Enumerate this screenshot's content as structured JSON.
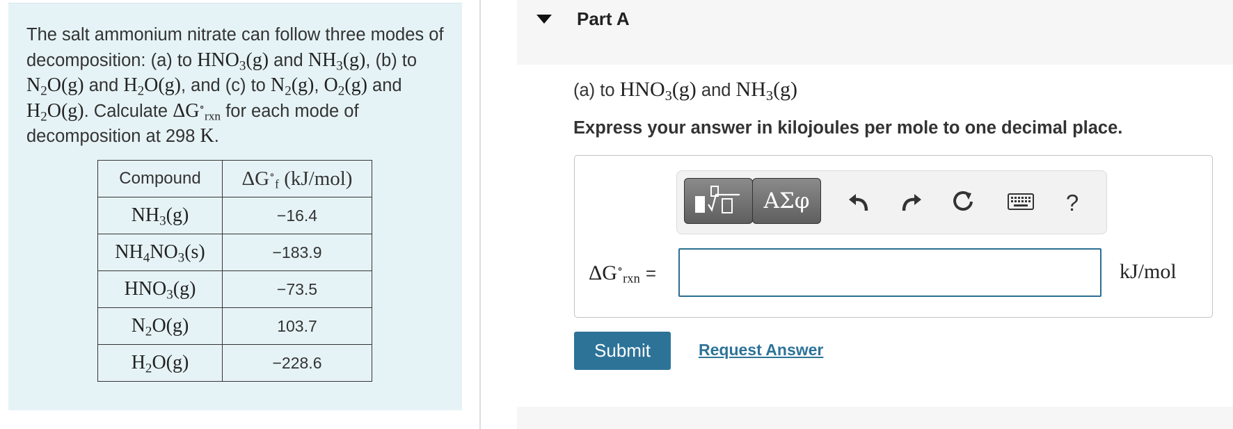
{
  "problem": {
    "t1": "The salt ammonium nitrate can follow three modes of decomposition: (a) to ",
    "t2": " and ",
    "t3": ", (b) to ",
    "t4": " and ",
    "t5": ", and (c) to ",
    "t6": ", ",
    "t7": " and ",
    "t8": ". Calculate ",
    "t9": " for each mode of decomposition at 298 ",
    "t10": ".",
    "hno3": "HNO",
    "hno3_sub": "3",
    "hno3_state": "(g)",
    "nh3": "NH",
    "nh3_sub": "3",
    "nh3_state": "(g)",
    "n2o_a": "N",
    "n2o_sub": "2",
    "n2o_b": "O(g)",
    "h2o_a": "H",
    "h2o_sub": "2",
    "h2o_b": "O(g)",
    "n2_a": "N",
    "n2_sub": "2",
    "n2_b": "(g)",
    "o2_a": "O",
    "o2_sub": "2",
    "o2_b": "(g)",
    "delta": "ΔG",
    "deg": "∘",
    "rxn": "rxn",
    "kelvin": "K"
  },
  "table": {
    "header_compound": "Compound",
    "header_delta": "ΔG",
    "header_deg": "∘",
    "header_f": "f",
    "header_unit": "(kJ/mol)",
    "rows": [
      {
        "a": "NH",
        "s1": "3",
        "b": "(g)",
        "s2": "",
        "c": "",
        "value": "−16.4"
      },
      {
        "a": "NH",
        "s1": "4",
        "b": "NO",
        "s2": "3",
        "c": "(s)",
        "value": "−183.9"
      },
      {
        "a": "HNO",
        "s1": "3",
        "b": "(g)",
        "s2": "",
        "c": "",
        "value": "−73.5"
      },
      {
        "a": "N",
        "s1": "2",
        "b": "O(g)",
        "s2": "",
        "c": "",
        "value": "103.7"
      },
      {
        "a": "H",
        "s1": "2",
        "b": "O(g)",
        "s2": "",
        "c": "",
        "value": "−228.6"
      }
    ]
  },
  "part": {
    "title": "Part A",
    "question_prefix": "(a) to ",
    "question_mid": " and ",
    "q_hno3": "HNO",
    "q_hno3_sub": "3",
    "q_hno3_state": "(g)",
    "q_nh3": "NH",
    "q_nh3_sub": "3",
    "q_nh3_state": "(g)",
    "instructions": "Express your answer in kilojoules per mole to one decimal place."
  },
  "toolbar": {
    "symbols_label": "ΑΣφ",
    "help_label": "?",
    "icons": [
      "templates-icon",
      "undo-icon",
      "redo-icon",
      "reset-icon",
      "keyboard-icon",
      "help-icon"
    ]
  },
  "answer": {
    "label_delta": "ΔG",
    "label_deg": "∘",
    "label_rxn": "rxn",
    "equals": "=",
    "input_value": "",
    "unit": "kJ/mol"
  },
  "actions": {
    "submit_label": "Submit",
    "request_label": "Request Answer"
  },
  "colors": {
    "panel_bg": "#e6f3f6",
    "accent": "#2d7398",
    "input_border": "#2a6e91"
  }
}
